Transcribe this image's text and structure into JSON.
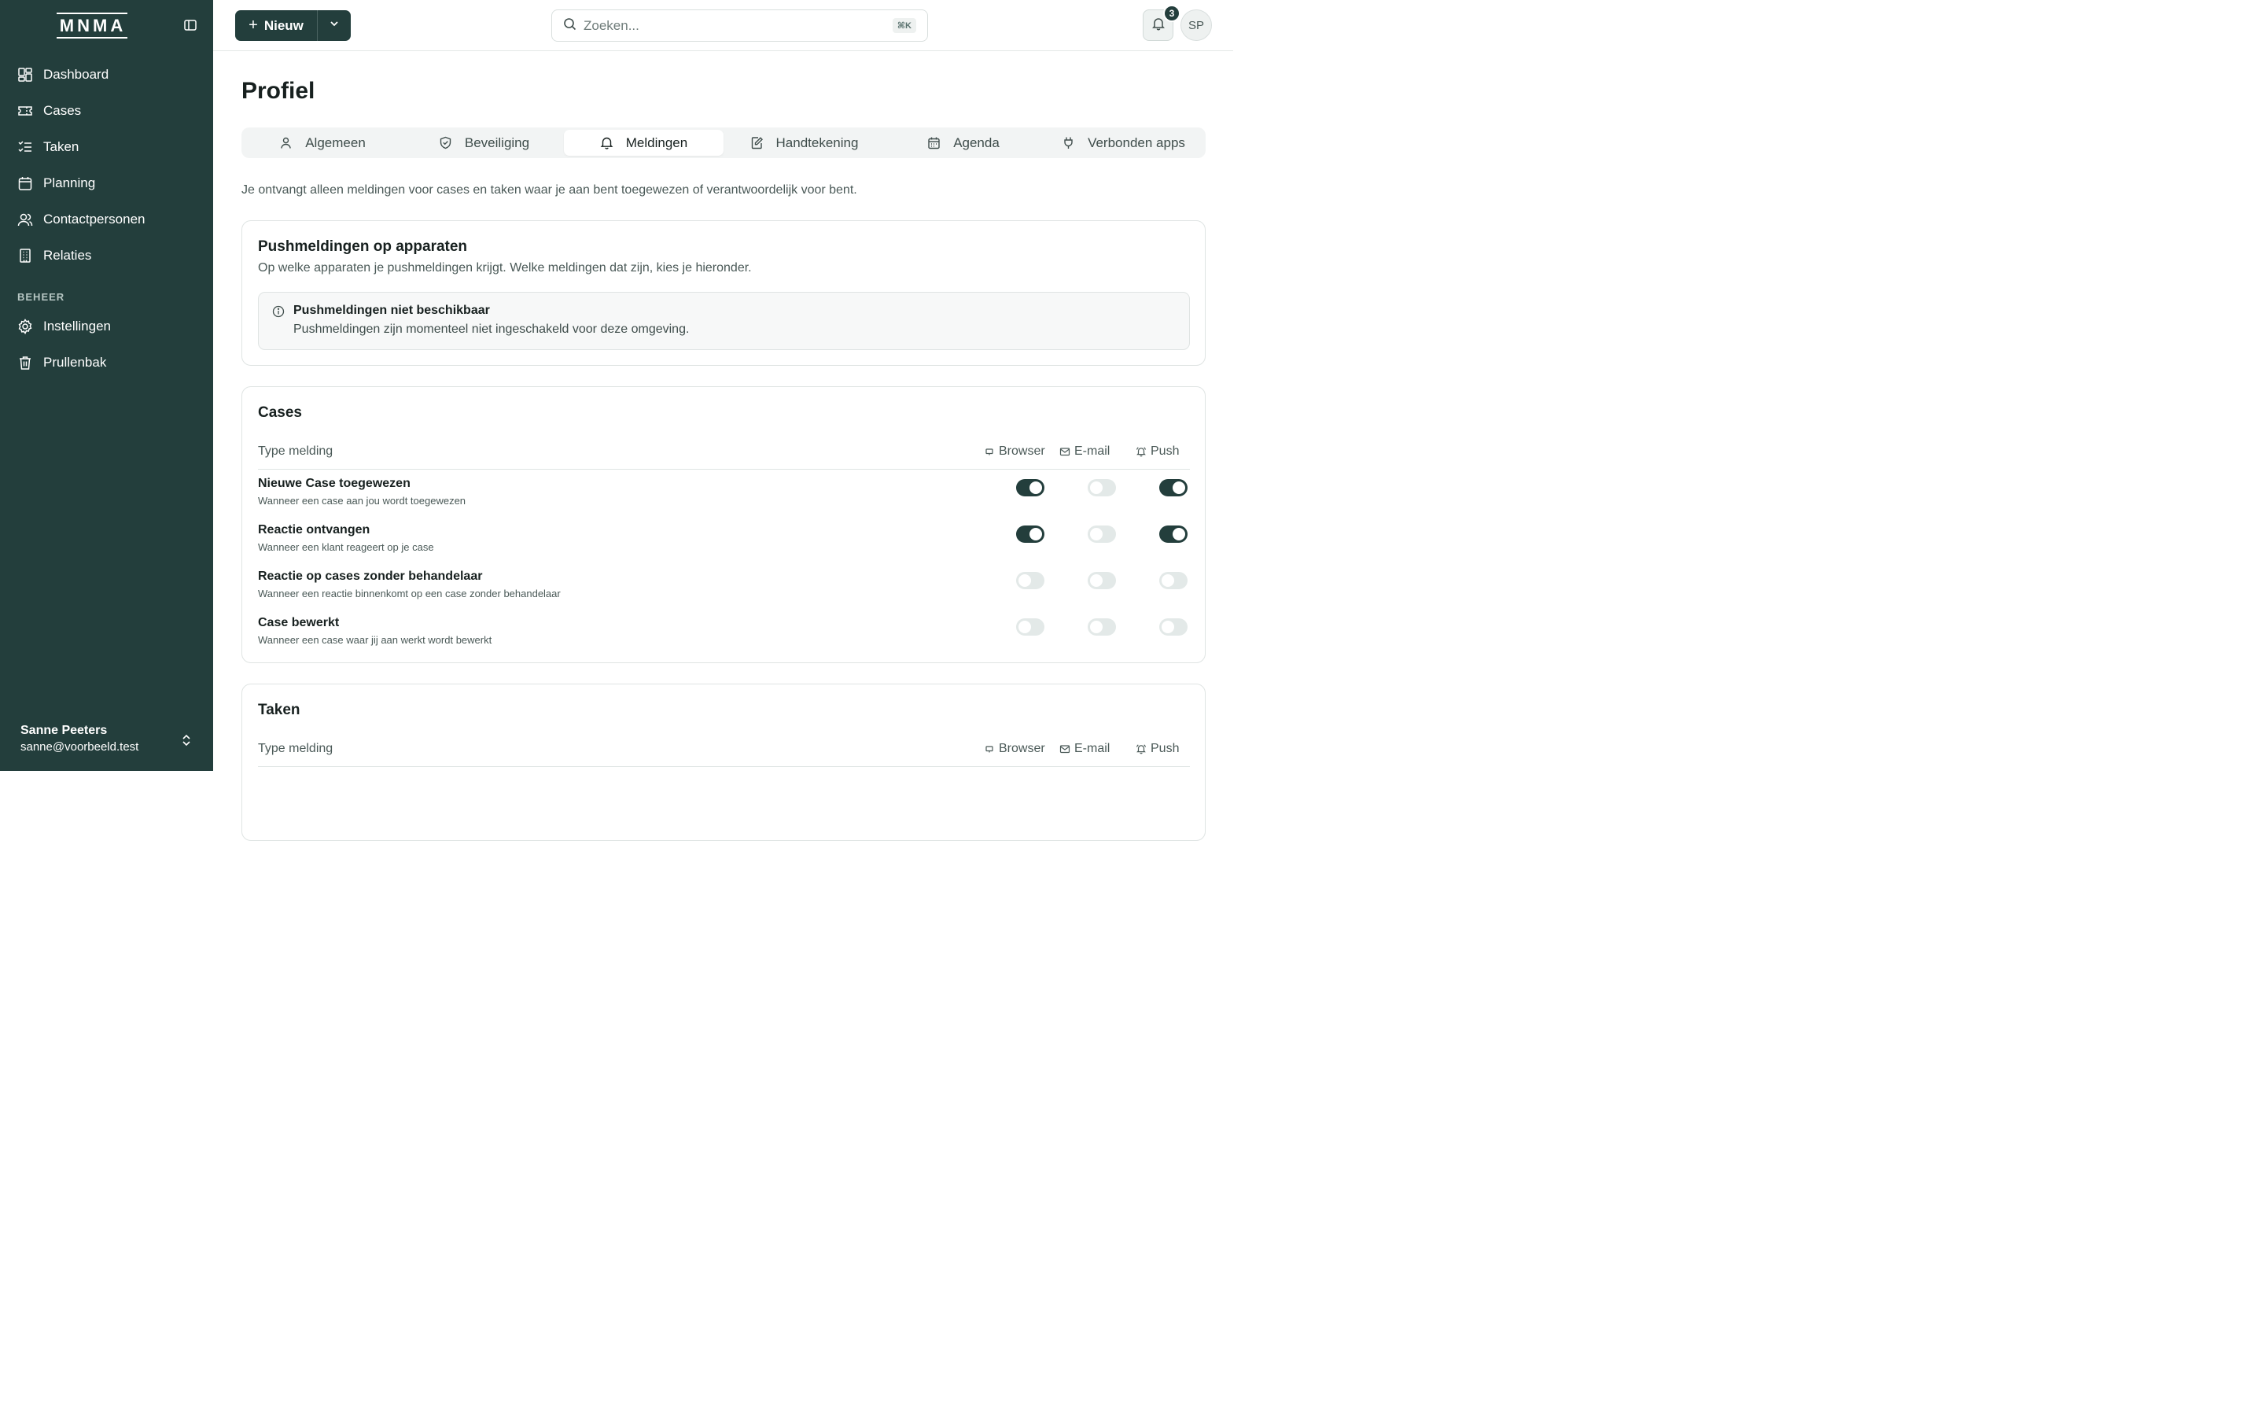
{
  "app": {
    "logo_text": "MNMA"
  },
  "sidebar": {
    "items": [
      {
        "label": "Dashboard",
        "icon": "dashboard-icon"
      },
      {
        "label": "Cases",
        "icon": "ticket-icon"
      },
      {
        "label": "Taken",
        "icon": "tasks-icon"
      },
      {
        "label": "Planning",
        "icon": "calendar-icon"
      },
      {
        "label": "Contactpersonen",
        "icon": "users-icon"
      },
      {
        "label": "Relaties",
        "icon": "building-icon"
      }
    ],
    "section_label": "BEHEER",
    "admin_items": [
      {
        "label": "Instellingen",
        "icon": "gear-icon"
      },
      {
        "label": "Prullenbak",
        "icon": "trash-icon"
      }
    ],
    "user": {
      "name": "Sanne Peeters",
      "email": "sanne@voorbeeld.test"
    }
  },
  "topbar": {
    "new_label": "Nieuw",
    "search_placeholder": "Zoeken...",
    "search_shortcut": "⌘K",
    "notification_count": "3",
    "avatar_initials": "SP"
  },
  "page": {
    "title": "Profiel",
    "tabs": [
      {
        "label": "Algemeen",
        "icon": "user-icon",
        "active": false
      },
      {
        "label": "Beveiliging",
        "icon": "shield-icon",
        "active": false
      },
      {
        "label": "Meldingen",
        "icon": "bell-icon",
        "active": true
      },
      {
        "label": "Handtekening",
        "icon": "signature-icon",
        "active": false
      },
      {
        "label": "Agenda",
        "icon": "calendar-icon",
        "active": false
      },
      {
        "label": "Verbonden apps",
        "icon": "plug-icon",
        "active": false
      }
    ],
    "intro": "Je ontvangt alleen meldingen voor cases en taken waar je aan bent toegewezen of verantwoordelijk voor bent."
  },
  "push_card": {
    "title": "Pushmeldingen op apparaten",
    "description": "Op welke apparaten je pushmeldingen krijgt. Welke meldingen dat zijn, kies je hieronder.",
    "alert_title": "Pushmeldingen niet beschikbaar",
    "alert_text": "Pushmeldingen zijn momenteel niet ingeschakeld voor deze omgeving."
  },
  "columns": {
    "type": "Type melding",
    "browser": "Browser",
    "email": "E-mail",
    "push": "Push"
  },
  "cases_card": {
    "title": "Cases",
    "rows": [
      {
        "title": "Nieuwe Case toegewezen",
        "desc": "Wanneer een case aan jou wordt toegewezen",
        "browser": true,
        "email": false,
        "push": true
      },
      {
        "title": "Reactie ontvangen",
        "desc": "Wanneer een klant reageert op je case",
        "browser": true,
        "email": false,
        "push": true
      },
      {
        "title": "Reactie op cases zonder behandelaar",
        "desc": "Wanneer een reactie binnenkomt op een case zonder behandelaar",
        "browser": false,
        "email": false,
        "push": false
      },
      {
        "title": "Case bewerkt",
        "desc": "Wanneer een case waar jij aan werkt wordt bewerkt",
        "browser": false,
        "email": false,
        "push": false
      }
    ]
  },
  "taken_card": {
    "title": "Taken"
  },
  "colors": {
    "sidebar": "#233e3c",
    "accent": "#233e3c",
    "toggle_off": "#e3e9e8"
  }
}
